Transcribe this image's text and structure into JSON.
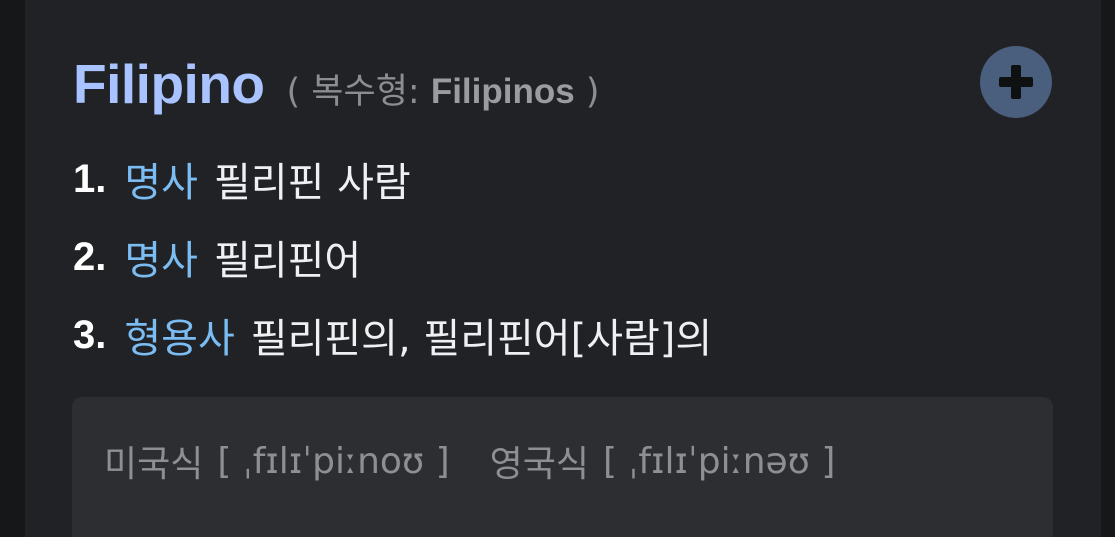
{
  "entry": {
    "headword": "Filipino",
    "plural_open": "( 복수형: ",
    "plural_word": "Filipinos",
    "plural_close": " )"
  },
  "add_button": {
    "icon": "plus-icon"
  },
  "senses": [
    {
      "num": "1.",
      "pos": "명사",
      "meaning": "필리핀 사람"
    },
    {
      "num": "2.",
      "pos": "명사",
      "meaning": "필리핀어"
    },
    {
      "num": "3.",
      "pos": "형용사",
      "meaning": "필리핀의, 필리핀어[사람]의"
    }
  ],
  "pronunciation": {
    "us_label": "미국식",
    "us_ipa": "[ ˌfɪlɪˈpiːnoʊ ]",
    "uk_label": "영국식",
    "uk_ipa": "[ ˌfɪlɪˈpiːnəʊ ]"
  },
  "colors": {
    "headword": "#a8c3ff",
    "pos": "#7bbcf2",
    "add_button_bg": "#4a5e7e",
    "card_bg": "#202225"
  }
}
